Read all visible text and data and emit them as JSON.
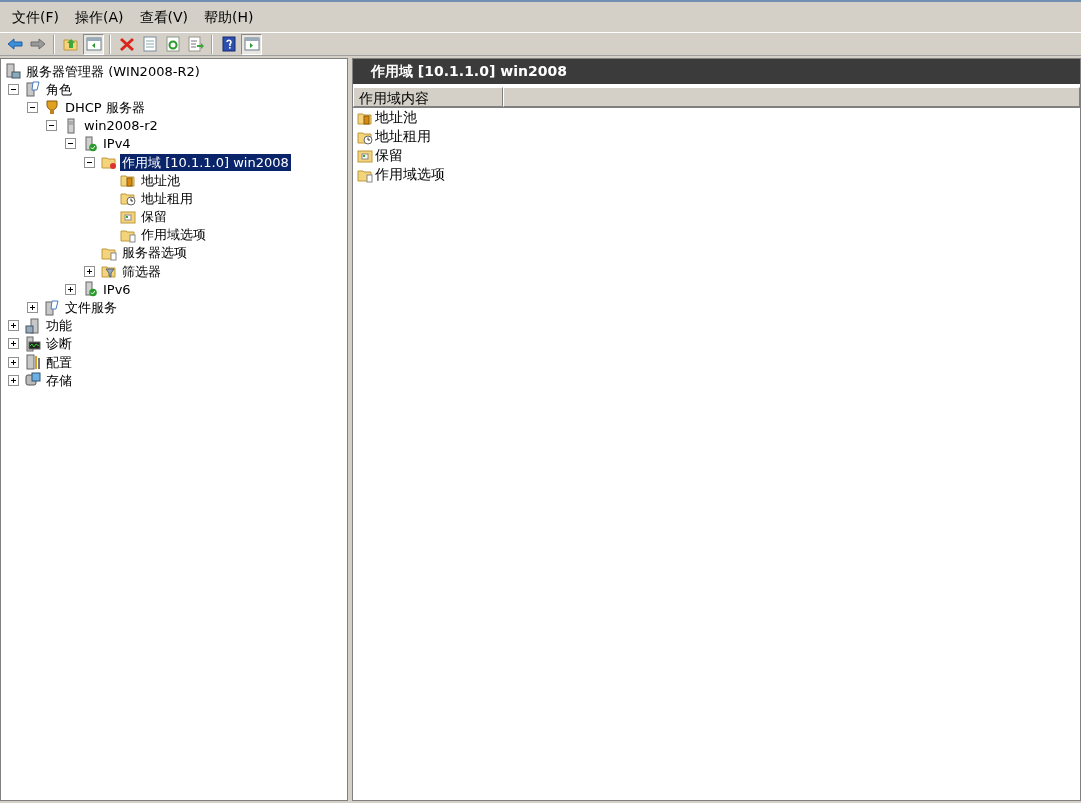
{
  "menu": [
    "文件(F)",
    "操作(A)",
    "查看(V)",
    "帮助(H)"
  ],
  "toolbar": [
    {
      "kind": "back",
      "pressed": false
    },
    {
      "kind": "forward",
      "pressed": false
    },
    {
      "kind": "separator"
    },
    {
      "kind": "up",
      "pressed": false
    },
    {
      "kind": "tree-toggle",
      "pressed": true
    },
    {
      "kind": "separator"
    },
    {
      "kind": "delete",
      "pressed": false
    },
    {
      "kind": "properties",
      "pressed": false
    },
    {
      "kind": "refresh",
      "pressed": false
    },
    {
      "kind": "export",
      "pressed": false
    },
    {
      "kind": "separator"
    },
    {
      "kind": "help",
      "pressed": false
    },
    {
      "kind": "action-pane",
      "pressed": true
    }
  ],
  "tree": [
    {
      "label": "服务器管理器 (WIN2008-R2)",
      "kind": "server",
      "selected": false,
      "children": [
        {
          "label": "角色",
          "kind": "roles",
          "expanded": true,
          "selected": false,
          "children": [
            {
              "label": "DHCP 服务器",
              "kind": "dhcp",
              "expanded": true,
              "selected": false,
              "children": [
                {
                  "label": "win2008-r2",
                  "kind": "tower",
                  "expanded": true,
                  "selected": false,
                  "children": [
                    {
                      "label": "IPv4",
                      "kind": "tower-ok",
                      "expanded": true,
                      "selected": false,
                      "children": [
                        {
                          "label": "作用域 [10.1.1.0] win2008",
                          "kind": "scope",
                          "expanded": true,
                          "selected": true,
                          "children": [
                            {
                              "label": "地址池",
                              "kind": "folder-pool",
                              "selected": false
                            },
                            {
                              "label": "地址租用",
                              "kind": "folder-clock",
                              "selected": false
                            },
                            {
                              "label": "保留",
                              "kind": "folder-grid",
                              "selected": false
                            },
                            {
                              "label": "作用域选项",
                              "kind": "folder-doc",
                              "selected": false
                            }
                          ]
                        },
                        {
                          "label": "服务器选项",
                          "kind": "folder-doc",
                          "selected": false
                        },
                        {
                          "label": "筛选器",
                          "kind": "folder-filter",
                          "expanded": false,
                          "selected": false
                        }
                      ]
                    },
                    {
                      "label": "IPv6",
                      "kind": "tower-ok",
                      "expanded": false,
                      "selected": false
                    }
                  ]
                }
              ]
            },
            {
              "label": "文件服务",
              "kind": "roles",
              "expanded": false,
              "selected": false
            }
          ]
        },
        {
          "label": "功能",
          "kind": "features",
          "expanded": false,
          "selected": false
        },
        {
          "label": "诊断",
          "kind": "diagnostics",
          "expanded": false,
          "selected": false
        },
        {
          "label": "配置",
          "kind": "config",
          "expanded": false,
          "selected": false
        },
        {
          "label": "存储",
          "kind": "storage",
          "expanded": false,
          "selected": false
        }
      ]
    }
  ],
  "detail": {
    "title": "作用域 [10.1.1.0] win2008",
    "columns": [
      "作用域内容"
    ],
    "items": [
      {
        "label": "地址池",
        "kind": "folder-pool"
      },
      {
        "label": "地址租用",
        "kind": "folder-clock"
      },
      {
        "label": "保留",
        "kind": "folder-grid"
      },
      {
        "label": "作用域选项",
        "kind": "folder-doc"
      }
    ]
  }
}
